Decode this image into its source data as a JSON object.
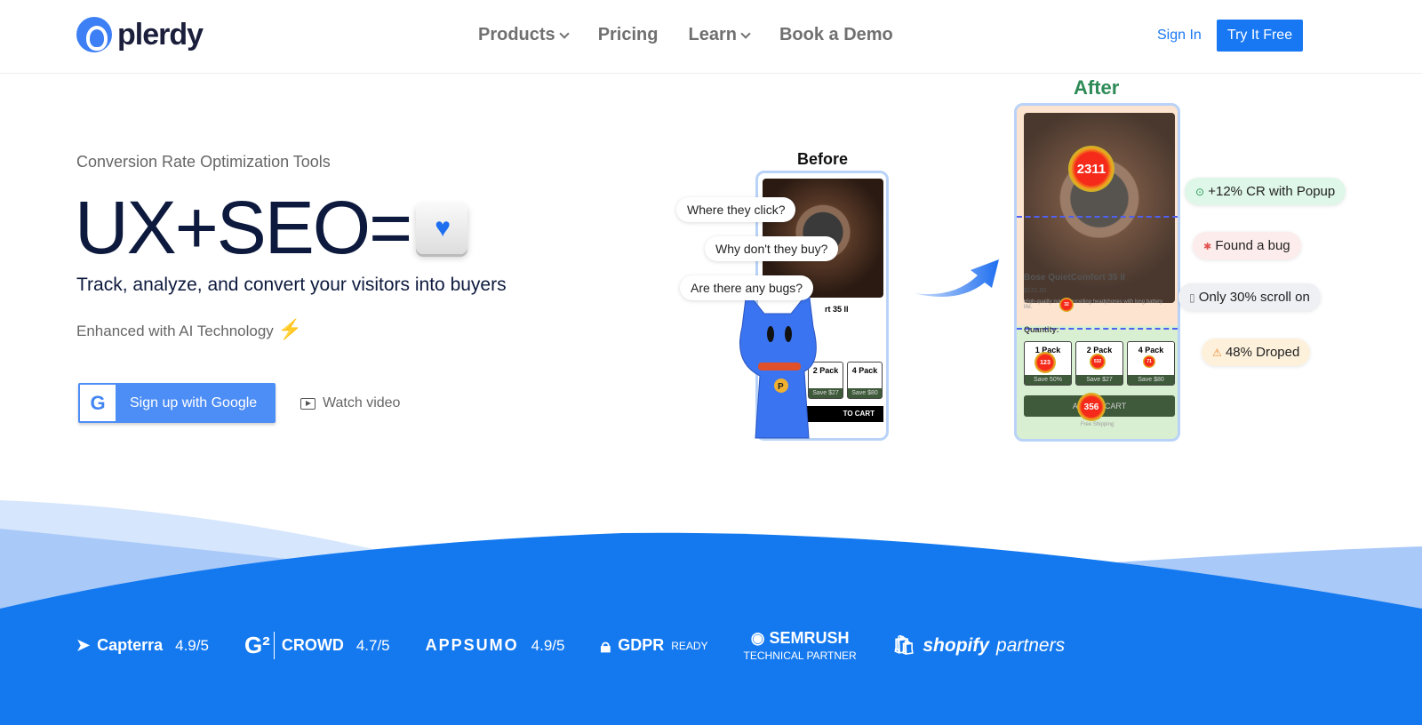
{
  "nav": {
    "brand": "plerdy",
    "items": [
      {
        "label": "Products",
        "dropdown": true
      },
      {
        "label": "Pricing"
      },
      {
        "label": "Learn",
        "dropdown": true
      },
      {
        "label": "Book a Demo"
      }
    ],
    "sign_in": "Sign In",
    "try_free": "Try It Free"
  },
  "hero": {
    "subtitle": "Conversion Rate Optimization Tools",
    "headline": "UX+SEO=",
    "tagline": "Track, analyze, and convert your visitors into buyers",
    "ai": "Enhanced with AI Technology",
    "google_button": "Sign up with Google",
    "watch_video": "Watch video"
  },
  "illustration": {
    "before_label": "Before",
    "after_label": "After",
    "questions": [
      "Where they click?",
      "Why don't they buy?",
      "Are there any bugs?"
    ],
    "product": {
      "name": "Bose QuietComfort 35 II",
      "price": "$121.00",
      "desc": "High-quality noise cancelling headphones with long battery life.",
      "quantity": "Quantity:",
      "packs": [
        {
          "name": "1 Pack",
          "save": "Save 50%"
        },
        {
          "name": "2 Pack",
          "save": "Save $27"
        },
        {
          "name": "4 Pack",
          "save": "Save $80"
        }
      ],
      "cart": "ADD TO CART",
      "shipping": "Free Shipping",
      "before_name": "rt 35 II",
      "before_cart": "TO CART"
    },
    "heat": {
      "image": "2311",
      "desc": "32",
      "pack1": "123",
      "pack2": "532",
      "pack4": "71",
      "cart": "356"
    },
    "insights": [
      {
        "icon": "check-circle-icon",
        "text": "+12% CR with Popup",
        "color": "#dff7e8"
      },
      {
        "icon": "bug-icon",
        "text": "Found a bug",
        "color": "#fdecec"
      },
      {
        "icon": "scroll-icon",
        "text": "Only 30% scroll on",
        "color": "#eef0f4"
      },
      {
        "icon": "warning-icon",
        "text": "48% Droped",
        "color": "#fdf1dc"
      }
    ]
  },
  "trust": [
    {
      "name": "Capterra",
      "rating": "4.9/5"
    },
    {
      "name": "CROWD",
      "rating": "4.7/5"
    },
    {
      "name": "APPSUMO",
      "rating": "4.9/5"
    },
    {
      "name": "GDPR",
      "sub": "READY"
    },
    {
      "name": "SEMRUSH",
      "sub": "TECHNICAL PARTNER"
    },
    {
      "name": "shopify",
      "sub": "partners"
    }
  ],
  "colors": {
    "primary": "#1877f2",
    "wave": "#1479ef",
    "headline": "#0d1a3d",
    "after": "#2e8b57"
  }
}
